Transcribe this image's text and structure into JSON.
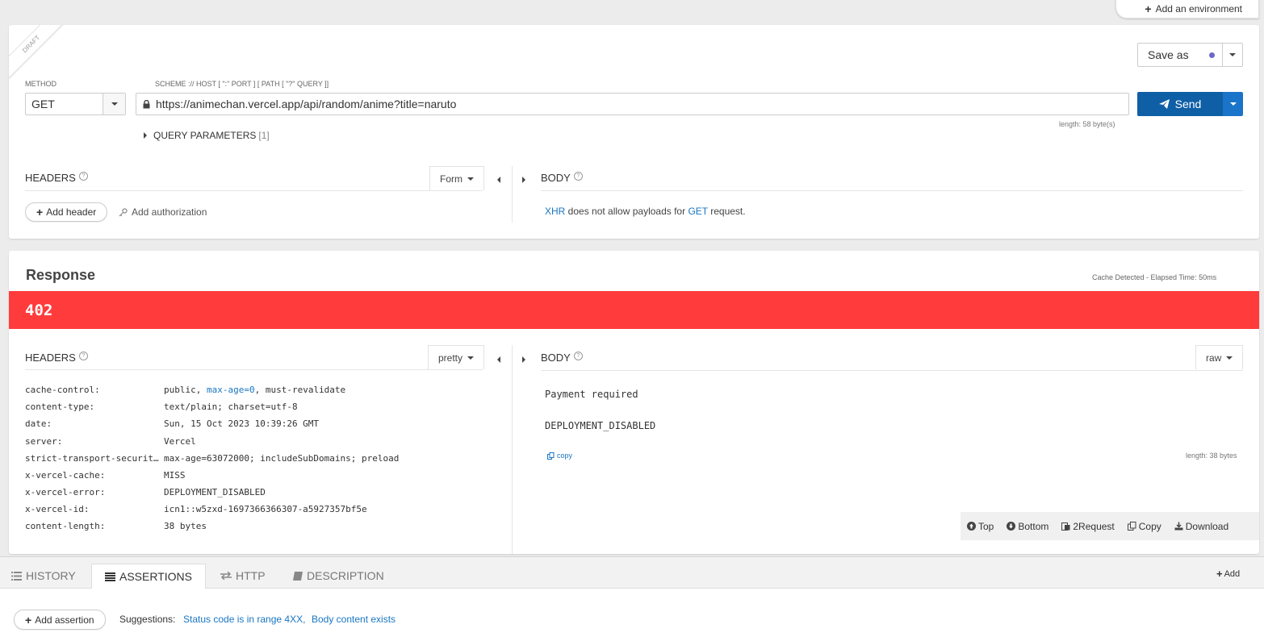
{
  "environment": {
    "add_label": "Add an environment"
  },
  "request": {
    "draft_label": "DRAFT",
    "method_label": "METHOD",
    "method_value": "GET",
    "scheme_label": "SCHEME :// HOST [ \":\" PORT ] [ PATH [ \"?\" QUERY ]]",
    "url": "https://animechan.vercel.app/api/random/anime?title=naruto",
    "length_label": "length: 58 byte(s)",
    "query_params_label": "QUERY PARAMETERS",
    "query_params_count": "[1]",
    "save_as_label": "Save as",
    "send_label": "Send",
    "headers_title": "HEADERS",
    "headers_mode": "Form",
    "add_header_label": "Add header",
    "add_authorization_label": "Add authorization",
    "body_title": "BODY",
    "body_msg_xhr": "XHR",
    "body_msg_mid": " does not allow payloads for ",
    "body_msg_get": "GET",
    "body_msg_end": " request."
  },
  "response": {
    "title": "Response",
    "meta": "Cache Detected - Elapsed Time: 50ms",
    "status_code": "402",
    "status_color": "#ff3b3b",
    "headers_title": "HEADERS",
    "headers_mode": "pretty",
    "headers": [
      {
        "key": "cache-control:",
        "value_pre": "public, ",
        "value_link": "max-age=0",
        "value_post": ", must-revalidate"
      },
      {
        "key": "content-type:",
        "value_pre": "text/plain; charset=utf-8",
        "value_link": "",
        "value_post": ""
      },
      {
        "key": "date:",
        "value_pre": "Sun, 15 Oct 2023 10:39:26 GMT",
        "value_link": "",
        "value_post": ""
      },
      {
        "key": "server:",
        "value_pre": "Vercel",
        "value_link": "",
        "value_post": ""
      },
      {
        "key": "strict-transport-securit…",
        "value_pre": "max-age=63072000; includeSubDomains; preload",
        "value_link": "",
        "value_post": ""
      },
      {
        "key": "x-vercel-cache:",
        "value_pre": "MISS",
        "value_link": "",
        "value_post": ""
      },
      {
        "key": "x-vercel-error:",
        "value_pre": "DEPLOYMENT_DISABLED",
        "value_link": "",
        "value_post": ""
      },
      {
        "key": "x-vercel-id:",
        "value_pre": "icn1::w5zxd-1697366366307-a5927357bf5e",
        "value_link": "",
        "value_post": ""
      },
      {
        "key": "content-length:",
        "value_pre": "38 bytes",
        "value_link": "",
        "value_post": ""
      }
    ],
    "body_title": "BODY",
    "body_mode": "raw",
    "body_line1": "Payment required",
    "body_line2": "DEPLOYMENT_DISABLED",
    "copy_label": "copy",
    "body_length": "length: 38 bytes",
    "toolbar": {
      "top": "Top",
      "bottom": "Bottom",
      "to_request": "2Request",
      "copy": "Copy",
      "download": "Download"
    }
  },
  "bottom_tabs": {
    "history": "HISTORY",
    "assertions": "ASSERTIONS",
    "http": "HTTP",
    "description": "DESCRIPTION",
    "add": "Add",
    "add_assertion": "Add assertion",
    "suggestions_label": "Suggestions:",
    "suggestion_1": "Status code is in range 4XX,",
    "suggestion_2": "Body content exists"
  }
}
